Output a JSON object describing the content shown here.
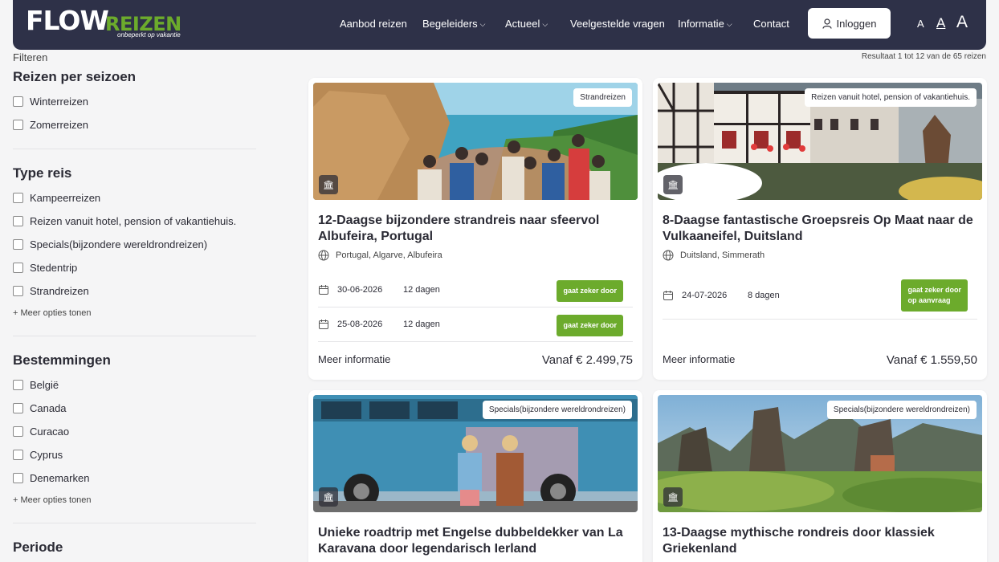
{
  "header": {
    "logo_flow": "FLOW",
    "logo_reizen": "REIZEN",
    "logo_tagline": "onbeperkt op vakantie",
    "nav": [
      {
        "label": "Aanbod reizen"
      },
      {
        "label": "Begeleiders"
      },
      {
        "label": "Actueel"
      },
      {
        "label": "Veelgestelde vragen"
      },
      {
        "label": "Informatie"
      },
      {
        "label": "Contact"
      }
    ],
    "login_label": "Inloggen",
    "font_small": "A",
    "font_medium": "A",
    "font_large": "A"
  },
  "filters": {
    "title": "Filteren",
    "result_count": "Resultaat 1 tot 12 van de 65 reizen",
    "seizoen": {
      "title": "Reizen per seizoen",
      "options": [
        "Winterreizen",
        "Zomerreizen"
      ]
    },
    "type": {
      "title": "Type reis",
      "options": [
        "Kampeerreizen",
        "Reizen vanuit hotel, pension of vakantiehuis.",
        "Specials(bijzondere wereldrondreizen)",
        "Stedentrip",
        "Strandreizen"
      ],
      "more": "+ Meer opties tonen"
    },
    "bestemmingen": {
      "title": "Bestemmingen",
      "options": [
        "België",
        "Canada",
        "Curacao",
        "Cyprus",
        "Denemarken"
      ],
      "more": "+ Meer opties tonen"
    },
    "periode": {
      "title": "Periode"
    }
  },
  "cards": [
    {
      "tag": "Strandreizen",
      "title": "12-Daagse bijzondere strandreis naar sfeervol Albufeira, Portugal",
      "location": "Portugal, Algarve, Albufeira",
      "dates": [
        {
          "date": "30-06-2026",
          "days": "12 dagen",
          "status": "gaat zeker door"
        },
        {
          "date": "25-08-2026",
          "days": "12 dagen",
          "status": "gaat zeker door"
        }
      ],
      "more": "Meer informatie",
      "price": "Vanaf € 2.499,75"
    },
    {
      "tag": "Reizen vanuit hotel, pension of vakantiehuis.",
      "title": "8-Daagse fantastische Groepsreis Op Maat naar de Vulkaaneifel, Duitsland",
      "location": "Duitsland, Simmerath",
      "dates": [
        {
          "date": "24-07-2026",
          "days": "8 dagen",
          "status_line1": "gaat zeker door",
          "status_line2": "op aanvraag"
        }
      ],
      "more": "Meer informatie",
      "price": "Vanaf € 1.559,50"
    },
    {
      "tag": "Specials(bijzondere wereldrondreizen)",
      "title": "Unieke roadtrip met Engelse dubbeldekker van La Karavana door legendarisch Ierland"
    },
    {
      "tag": "Specials(bijzondere wereldrondreizen)",
      "title": "13-Daagse mythische rondreis door klassiek Griekenland"
    }
  ],
  "colors": {
    "navbar": "#2e3148",
    "accent_green": "#6cab2c",
    "background": "#f5f5f6"
  }
}
